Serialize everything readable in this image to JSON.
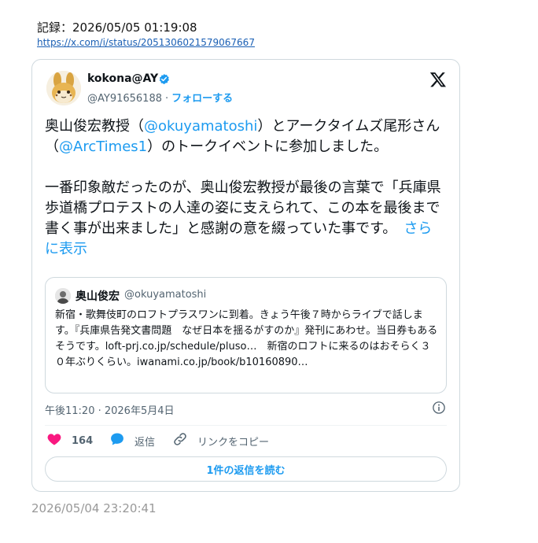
{
  "header": {
    "record_label": "記録：2026/05/05 01:19:08",
    "source_link": "https://x.com/i/status/2051306021579067667"
  },
  "tweet": {
    "author_name": "kokona@AY",
    "author_handle": "@AY91656188",
    "separator": "·",
    "follow_label": "フォローする",
    "verified_icon": "verified-badge-icon",
    "brand_icon": "x-logo-icon",
    "text": {
      "p1_part1": "奥山俊宏教授（",
      "p1_mention1": "@okuyamatoshi",
      "p1_part2": "）とアークタイムズ尾形さん（",
      "p1_mention2": "@ArcTimes1",
      "p1_part3": "）のトークイベントに参加しました。",
      "p2": "一番印象敵だったのが、奥山俊宏教授が最後の言葉で「兵庫県歩道橋プロテストの人達の姿に支えられて、この本を最後まで書く事が出来ました」と感謝の意を綴っていた事です。",
      "more_label": "さらに表示"
    },
    "quote": {
      "name": "奥山俊宏",
      "handle": "@okuyamatoshi",
      "text": "新宿・歌舞伎町のロフトプラスワンに到着。きょう午後７時からライブで話します。『兵庫県告発文書問題　なぜ日本を揺るがすのか』発刊にあわせ。当日券もあるそうです。loft-prj.co.jp/schedule/pluso…　新宿のロフトに来るのはおそらく３０年ぶりくらい。iwanami.co.jp/book/b10160890…"
    },
    "timestamp": "午後11:20 · 2026年5月4日",
    "actions": {
      "like_count": "164",
      "reply_label": "返信",
      "copy_link_label": "リンクをコピー"
    },
    "read_replies_label": "1件の返信を読む"
  },
  "footer": {
    "timestamp": "2026/05/04 23:20:41"
  },
  "colors": {
    "accent": "#1d9bf0",
    "like": "#f91880",
    "secondary_text": "#536471",
    "border": "#cfd9de"
  }
}
